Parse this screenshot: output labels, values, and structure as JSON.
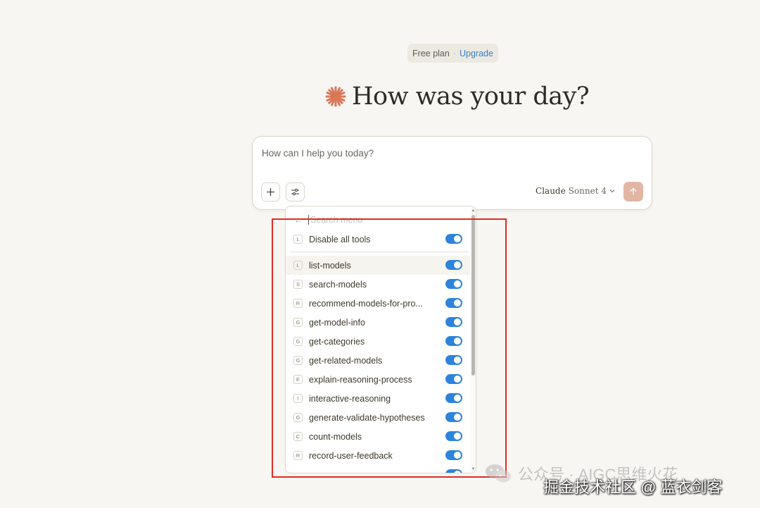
{
  "plan": {
    "label": "Free plan",
    "separator": "·",
    "upgrade": "Upgrade"
  },
  "greeting": {
    "icon": "claude-sparkle-icon",
    "text": "How was your day?"
  },
  "composer": {
    "placeholder": "How can I help you today?",
    "model_name": "Claude",
    "model_version": "Sonnet 4",
    "send_icon": "arrow-up-icon"
  },
  "menu": {
    "search_placeholder": "Search menu",
    "disable_all": {
      "letter": "L",
      "label": "Disable all tools",
      "enabled": true
    },
    "items": [
      {
        "letter": "L",
        "label": "list-models",
        "enabled": true
      },
      {
        "letter": "S",
        "label": "search-models",
        "enabled": true
      },
      {
        "letter": "R",
        "label": "recommend-models-for-pro...",
        "enabled": true
      },
      {
        "letter": "G",
        "label": "get-model-info",
        "enabled": true
      },
      {
        "letter": "G",
        "label": "get-categories",
        "enabled": true
      },
      {
        "letter": "G",
        "label": "get-related-models",
        "enabled": true
      },
      {
        "letter": "E",
        "label": "explain-reasoning-process",
        "enabled": true
      },
      {
        "letter": "I",
        "label": "interactive-reasoning",
        "enabled": true
      },
      {
        "letter": "G",
        "label": "generate-validate-hypotheses",
        "enabled": true
      },
      {
        "letter": "C",
        "label": "count-models",
        "enabled": true
      },
      {
        "letter": "R",
        "label": "record-user-feedback",
        "enabled": true
      }
    ]
  },
  "watermark": {
    "text": "公众号 · AIGC思维火花",
    "credit": "掘金技术社区 @ 蓝衣剑客"
  },
  "colors": {
    "accent": "#2c84db",
    "brand": "#d97757",
    "highlight": "#e02b25"
  }
}
